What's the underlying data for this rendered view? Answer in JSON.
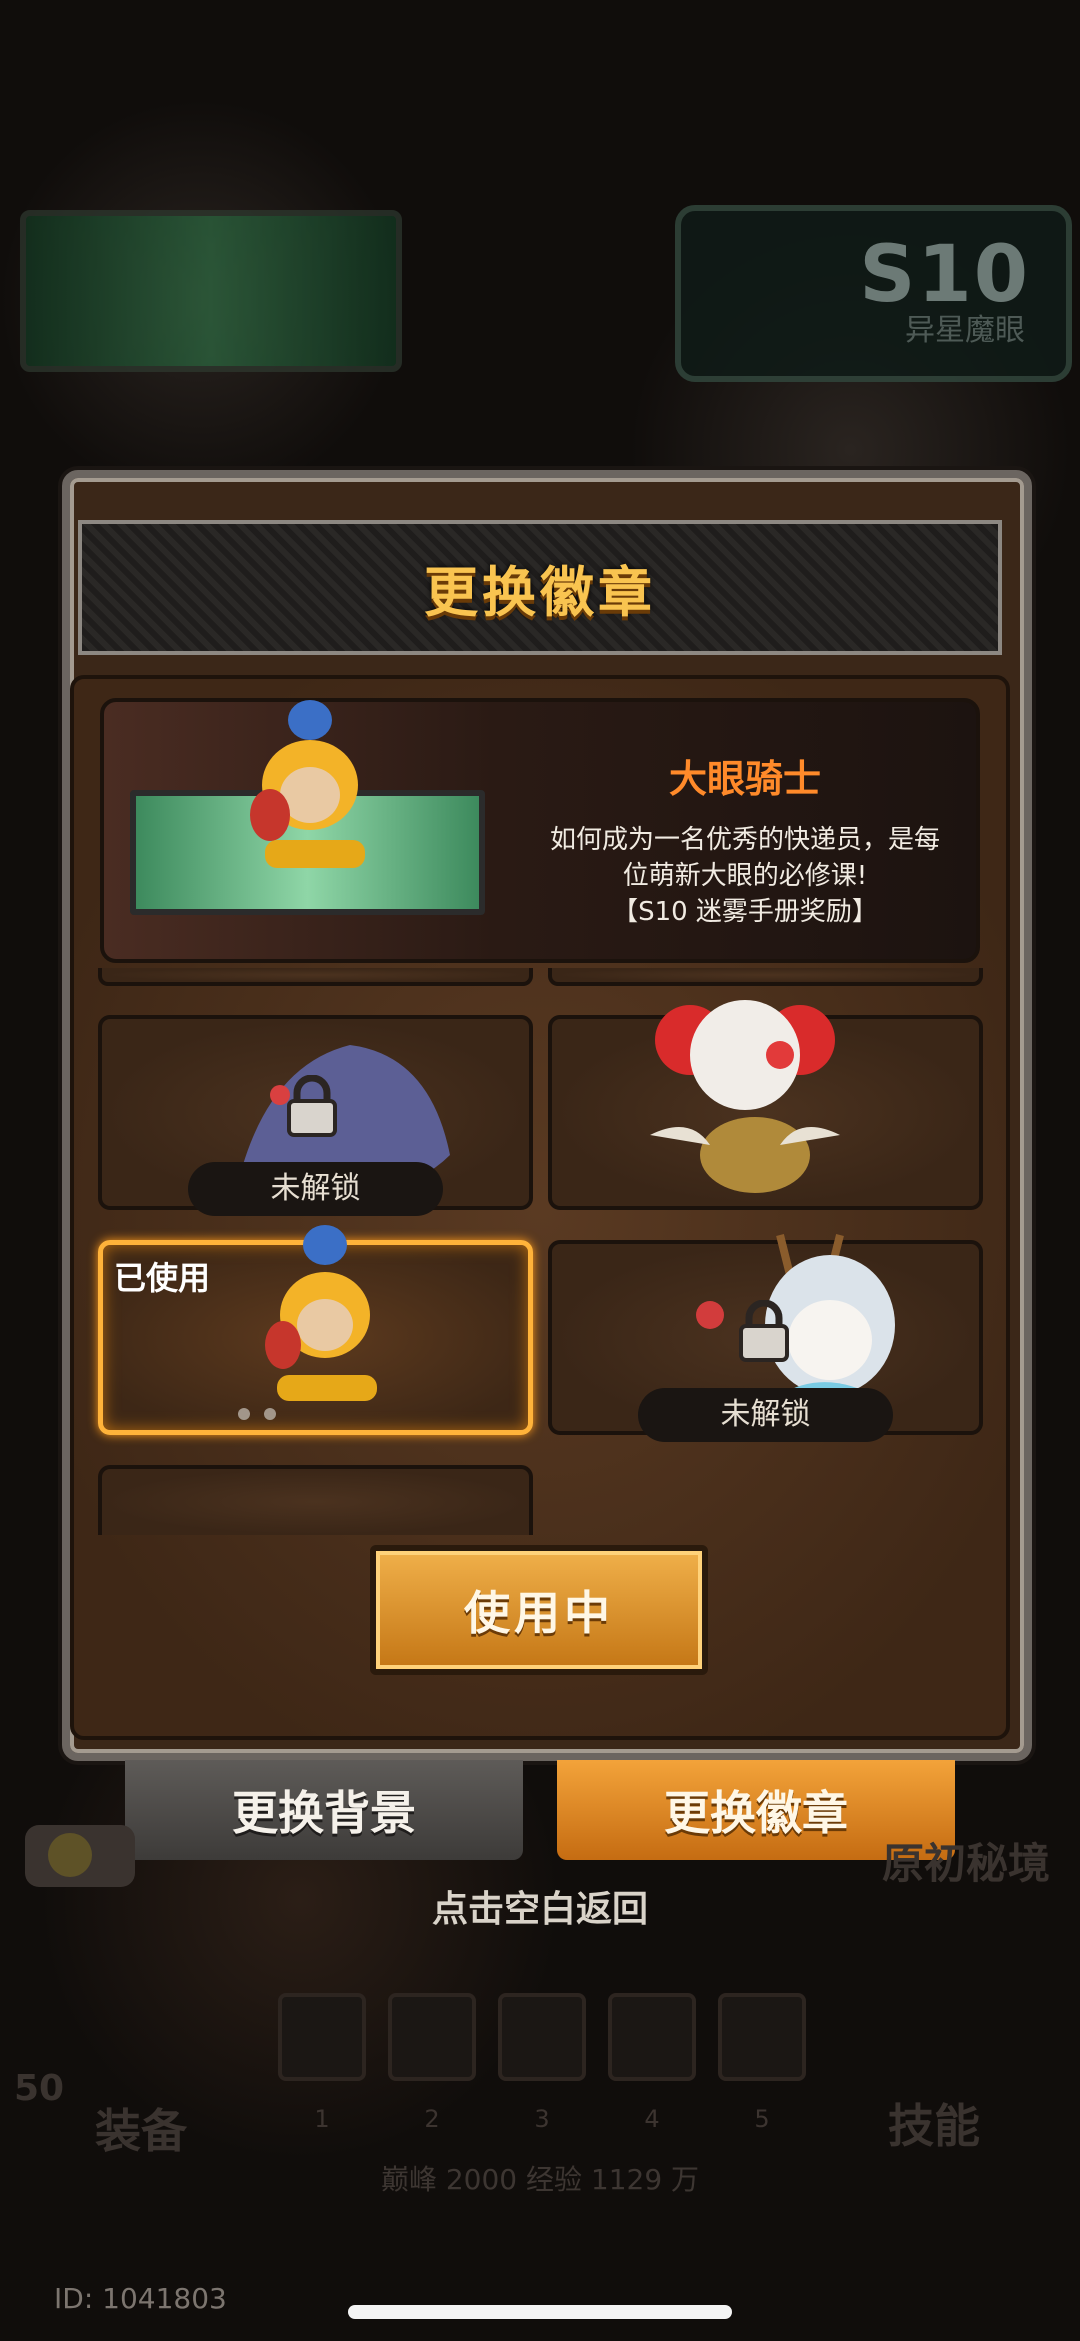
{
  "dialog": {
    "title": "更换徽章",
    "selected_badge": {
      "name": "大眼骑士",
      "description_line1": "如何成为一名优秀的快递员，是每",
      "description_line2": "位萌新大眼的必修课!",
      "description_line3": "【S10 迷雾手册奖励】"
    },
    "badges": [
      {
        "status": "未解锁"
      },
      {
        "status": ""
      },
      {
        "status": "已使用"
      },
      {
        "status": "未解锁"
      }
    ],
    "use_button_label": "使用中"
  },
  "tabs": {
    "background_label": "更换背景",
    "badge_label": "更换徽章"
  },
  "hint": "点击空白返回",
  "background_scene": {
    "season_label": "S10",
    "season_subtitle": "异星魔眼",
    "secret_realm_label": "原初秘境",
    "equip_label": "装备",
    "skill_label": "技能",
    "level": "50",
    "skill_slots": [
      "1",
      "2",
      "3",
      "4",
      "5"
    ],
    "stats": "巅峰 2000   经验 1129 万"
  },
  "user_id": "ID: 1041803"
}
